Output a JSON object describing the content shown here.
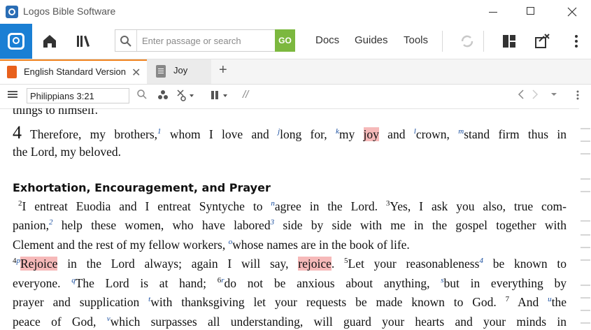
{
  "window": {
    "title": "Logos Bible Software"
  },
  "toolbar": {
    "search_placeholder": "Enter passage or search",
    "go_label": "GO",
    "menu": [
      "Docs",
      "Guides",
      "Tools"
    ]
  },
  "tabs": [
    {
      "label": "English Standard Version",
      "active": true
    },
    {
      "label": "Joy",
      "active": false
    }
  ],
  "reference": {
    "value": "Philippians 3:21"
  },
  "reader": {
    "cut_line": "things to himself.",
    "chapter_number": "4",
    "v1_line1_parts": [
      "Therefore, my brothers,",
      "1",
      " whom I love and ",
      "j",
      "long for, ",
      "k",
      "my ",
      "joy",
      " and ",
      "l",
      "crown, ",
      "m",
      "stand firm thus in"
    ],
    "v1_line2": "the Lord, my beloved.",
    "heading": "Exhortation, Encouragement, and Prayer",
    "l3_parts": [
      "2",
      "I entreat Euodia and I entreat Syntyche to ",
      "n",
      "agree in the Lord. ",
      "3",
      "Yes, I ask you also, true com-"
    ],
    "l4_parts": [
      "panion,",
      "2",
      " help these women, who have labored",
      "3",
      " side by side with me in the gospel together with"
    ],
    "l5_parts": [
      "Clement and the rest of my fellow workers, ",
      "o",
      "whose names are in the book of life."
    ],
    "l6_parts": [
      "4",
      "p",
      "Rejoice",
      " in the Lord always; again I will say, ",
      "rejoice",
      ". ",
      "5",
      "Let your reasonableness",
      "4",
      " be known to"
    ],
    "l7_parts": [
      "everyone. ",
      "q",
      "The Lord is at hand; ",
      "6",
      "r",
      "do not be anxious about anything, ",
      "s",
      "but in everything by"
    ],
    "l8_parts": [
      "prayer and supplication ",
      "t",
      "with thanksgiving let your requests be made known to God. ",
      "7",
      " And ",
      "u",
      "the"
    ],
    "l9_parts": [
      "peace of God, ",
      "v",
      "which surpasses all understanding, will guard your hearts and your minds in"
    ]
  },
  "colors": {
    "accent_blue": "#1a7fd4",
    "go_green": "#7cb83f",
    "tab_orange": "#f0821e",
    "highlight": "#f6b9b9"
  },
  "icons": [
    "logos-home-icon",
    "home-icon",
    "library-icon",
    "search-icon",
    "sync-icon",
    "layout-icon",
    "close-panel-icon",
    "more-icon",
    "hamburger-icon",
    "resource-search-icon",
    "visual-filters-icon",
    "interlinear-icon",
    "parallel-icon",
    "annotation-icon",
    "back-icon",
    "forward-icon",
    "history-icon",
    "panel-menu-icon"
  ]
}
